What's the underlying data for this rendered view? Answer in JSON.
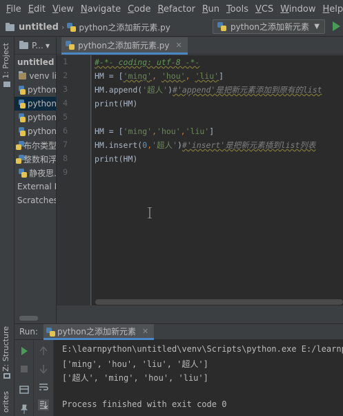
{
  "menu": [
    {
      "key": "F",
      "rest": "ile"
    },
    {
      "key": "E",
      "rest": "dit"
    },
    {
      "key": "V",
      "rest": "iew"
    },
    {
      "key": "N",
      "rest": "avigate"
    },
    {
      "key": "C",
      "rest": "ode"
    },
    {
      "key": "R",
      "rest": "efactor"
    },
    {
      "key": "R",
      "rest": "un"
    },
    {
      "key": "T",
      "rest": "ools"
    },
    {
      "key": "V",
      "rest": "CS"
    },
    {
      "key": "W",
      "rest": "indow"
    },
    {
      "key": "H",
      "rest": "elp"
    }
  ],
  "navbar": {
    "project": "untitled",
    "file": "python之添加新元素.py"
  },
  "run_config": {
    "name": "python之添加新元素"
  },
  "left_strip": {
    "project_tab": "1: Project",
    "structure_tab": "Z: Structure",
    "favorites_tab": "orites"
  },
  "project_panel": {
    "title": "P...",
    "items": [
      {
        "label": "untitled",
        "kind": "folder"
      },
      {
        "label": "venv li",
        "kind": "folder"
      },
      {
        "label": "python",
        "kind": "py"
      },
      {
        "label": "python",
        "kind": "py",
        "selected": true
      },
      {
        "label": "python",
        "kind": "py"
      },
      {
        "label": "python",
        "kind": "py"
      },
      {
        "label": "布尔类型",
        "kind": "py"
      },
      {
        "label": "整数和浮",
        "kind": "py"
      },
      {
        "label": "静夜思.",
        "kind": "py"
      },
      {
        "label": "External L",
        "kind": "lib"
      },
      {
        "label": "Scratches",
        "kind": "scratch"
      }
    ]
  },
  "editor": {
    "tab_label": "python之添加新元素.py",
    "line_numbers": [
      "1",
      "2",
      "3",
      "4",
      "5",
      "6",
      "7",
      "8",
      "9"
    ],
    "lines": {
      "l1": "#-*- coding: utf-8 -*-",
      "l2_a": "HM = [",
      "l2_b": "'ming'",
      "l2_c": ", ",
      "l2_d": "'hou'",
      "l2_e": ", ",
      "l2_f": "'liu'",
      "l2_g": "]",
      "l3_a": "HM.append(",
      "l3_b": "'超人'",
      "l3_c": ")",
      "l3_d": "#'append'是把新元素添加到原有的list",
      "l4": "print(HM)",
      "l6_a": "HM = [",
      "l6_b": "'ming'",
      "l6_c": ",",
      "l6_d": "'hou'",
      "l6_e": ",",
      "l6_f": "'liu'",
      "l6_g": "]",
      "l7_a": "HM.insert(",
      "l7_b": "0",
      "l7_c": ",",
      "l7_d": "'超人'",
      "l7_e": ")",
      "l7_f": "#'insert'是把新元素插到list列表",
      "l8": "print(HM)"
    }
  },
  "run_panel": {
    "label": "Run:",
    "tab": "python之添加新元素",
    "output": [
      "E:\\learnpython\\untitled\\venv\\Scripts\\python.exe E:/learnpy",
      "['ming', 'hou', 'liu', '超人']",
      "['超人', 'ming', 'hou', 'liu']",
      "",
      "Process finished with exit code 0"
    ]
  },
  "colors": {
    "background": "#2b2b2b",
    "chrome": "#3c3f41",
    "run_green": "#499c54",
    "accent_blue": "#4a88c7"
  }
}
